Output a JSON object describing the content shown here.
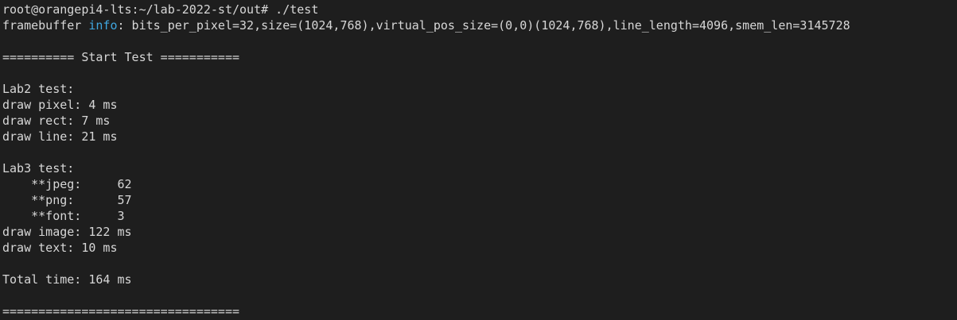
{
  "terminal": {
    "prompt": "root@orangepi4-lts:~/lab-2022-st/out# ",
    "command": "./test",
    "fb_prefix": "framebuffer ",
    "fb_info_word": "info",
    "fb_rest": ": bits_per_pixel=32,size=(1024,768),virtual_pos_size=(0,0)(1024,768),line_length=4096,smem_len=3145728",
    "start_banner": "========== Start Test ===========",
    "lab2_title": "Lab2 test:",
    "draw_pixel": "draw pixel: 4 ms",
    "draw_rect": "draw rect: 7 ms",
    "draw_line": "draw line: 21 ms",
    "lab3_title": "Lab3 test:",
    "jpeg": "    **jpeg:     62",
    "png": "    **png:      57",
    "font": "    **font:     3",
    "draw_image": "draw image: 122 ms",
    "draw_text": "draw text: 10 ms",
    "total_time": "Total time: 164 ms",
    "end_banner": "================================="
  },
  "colors": {
    "background": "#1e1e1e",
    "text": "#d7d7d7",
    "info_highlight": "#3fa7e0"
  }
}
